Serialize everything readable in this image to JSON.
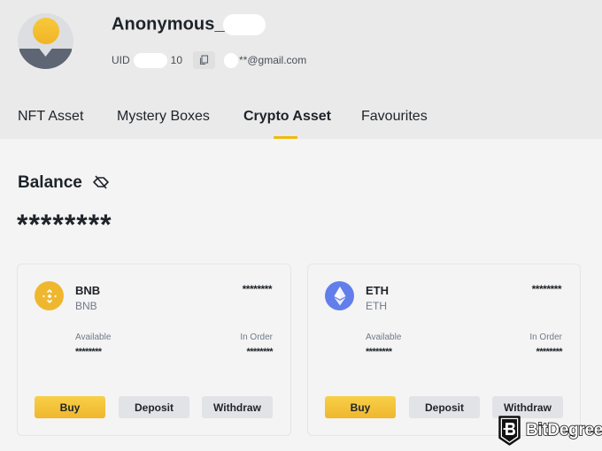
{
  "profile": {
    "username": "Anonymous_",
    "uid_label": "UID",
    "uid_suffix": "10",
    "email": "**@gmail.com",
    "colors": {
      "avatar_sun": "#f0b90b",
      "avatar_body": "#5e6673"
    }
  },
  "tabs": [
    {
      "label": "NFT Asset",
      "active": false
    },
    {
      "label": "Mystery Boxes",
      "active": false
    },
    {
      "label": "Crypto Asset",
      "active": true
    },
    {
      "label": "Favourites",
      "active": false
    }
  ],
  "balance": {
    "title": "Balance",
    "value": "********",
    "visibility_icon": "eye-off-icon"
  },
  "assets": [
    {
      "symbol": "BNB",
      "name": "BNB",
      "total": "********",
      "available_label": "Available",
      "available": "********",
      "in_order_label": "In Order",
      "in_order": "********",
      "icon_color": "#f0b90b",
      "buttons": {
        "buy": "Buy",
        "deposit": "Deposit",
        "withdraw": "Withdraw"
      }
    },
    {
      "symbol": "ETH",
      "name": "ETH",
      "total": "********",
      "available_label": "Available",
      "available": "********",
      "in_order_label": "In Order",
      "in_order": "********",
      "icon_color": "#627eea",
      "buttons": {
        "buy": "Buy",
        "deposit": "Deposit",
        "withdraw": "Withdraw"
      }
    }
  ],
  "watermark": {
    "text": "BitDegree"
  },
  "colors": {
    "accent": "#f0b90b",
    "header_bg": "#eaeaea",
    "page_bg": "#f4f4f4"
  }
}
